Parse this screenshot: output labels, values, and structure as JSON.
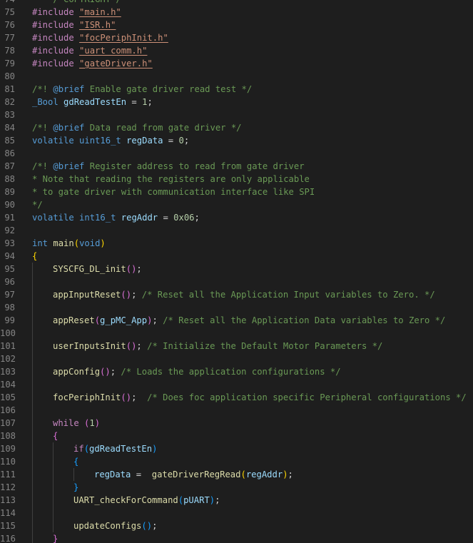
{
  "editor": {
    "language": "c",
    "lines": [
      {
        "n": "74",
        "indent": 0,
        "tokens": [
          {
            "t": "    /*COPYRIGHT*/",
            "c": "com"
          }
        ]
      },
      {
        "n": "75",
        "indent": 0,
        "tokens": [
          {
            "t": "#include",
            "c": "pp"
          },
          {
            "t": " ",
            "c": "plain"
          },
          {
            "t": "\"main.h\"",
            "c": "str"
          }
        ]
      },
      {
        "n": "76",
        "indent": 0,
        "tokens": [
          {
            "t": "#include",
            "c": "pp"
          },
          {
            "t": " ",
            "c": "plain"
          },
          {
            "t": "\"ISR.h\"",
            "c": "str"
          }
        ]
      },
      {
        "n": "77",
        "indent": 0,
        "tokens": [
          {
            "t": "#include",
            "c": "pp"
          },
          {
            "t": " ",
            "c": "plain"
          },
          {
            "t": "\"focPeriphInit.h\"",
            "c": "str"
          }
        ]
      },
      {
        "n": "78",
        "indent": 0,
        "tokens": [
          {
            "t": "#include",
            "c": "pp"
          },
          {
            "t": " ",
            "c": "plain"
          },
          {
            "t": "\"uart_comm.h\"",
            "c": "str"
          }
        ]
      },
      {
        "n": "79",
        "indent": 0,
        "tokens": [
          {
            "t": "#include",
            "c": "pp"
          },
          {
            "t": " ",
            "c": "plain"
          },
          {
            "t": "\"gateDriver.h\"",
            "c": "str"
          }
        ]
      },
      {
        "n": "80",
        "indent": 0,
        "tokens": []
      },
      {
        "n": "81",
        "indent": 0,
        "tokens": [
          {
            "t": "/*! ",
            "c": "com"
          },
          {
            "t": "@brief",
            "c": "tag"
          },
          {
            "t": " Enable gate driver read test */",
            "c": "com"
          }
        ]
      },
      {
        "n": "82",
        "indent": 0,
        "tokens": [
          {
            "t": "_Bool",
            "c": "kw"
          },
          {
            "t": " ",
            "c": "plain"
          },
          {
            "t": "gdReadTestEn",
            "c": "var"
          },
          {
            "t": " = ",
            "c": "plain"
          },
          {
            "t": "1",
            "c": "num"
          },
          {
            "t": ";",
            "c": "plain"
          }
        ]
      },
      {
        "n": "83",
        "indent": 0,
        "tokens": []
      },
      {
        "n": "84",
        "indent": 0,
        "tokens": [
          {
            "t": "/*! ",
            "c": "com"
          },
          {
            "t": "@brief",
            "c": "tag"
          },
          {
            "t": " Data read from gate driver */",
            "c": "com"
          }
        ]
      },
      {
        "n": "85",
        "indent": 0,
        "tokens": [
          {
            "t": "volatile",
            "c": "kw"
          },
          {
            "t": " ",
            "c": "plain"
          },
          {
            "t": "uint16_t",
            "c": "kw"
          },
          {
            "t": " ",
            "c": "plain"
          },
          {
            "t": "regData",
            "c": "var"
          },
          {
            "t": " = ",
            "c": "plain"
          },
          {
            "t": "0",
            "c": "num"
          },
          {
            "t": ";",
            "c": "plain"
          }
        ]
      },
      {
        "n": "86",
        "indent": 0,
        "tokens": []
      },
      {
        "n": "87",
        "indent": 0,
        "tokens": [
          {
            "t": "/*! ",
            "c": "com"
          },
          {
            "t": "@brief",
            "c": "tag"
          },
          {
            "t": " Register address to read from gate driver",
            "c": "com"
          }
        ]
      },
      {
        "n": "88",
        "indent": 0,
        "tokens": [
          {
            "t": "* Note that reading the registers are only applicable",
            "c": "com"
          }
        ]
      },
      {
        "n": "89",
        "indent": 0,
        "tokens": [
          {
            "t": "* to gate driver with communication interface like SPI",
            "c": "com"
          }
        ]
      },
      {
        "n": "90",
        "indent": 0,
        "tokens": [
          {
            "t": "*/",
            "c": "com"
          }
        ]
      },
      {
        "n": "91",
        "indent": 0,
        "tokens": [
          {
            "t": "volatile",
            "c": "kw"
          },
          {
            "t": " ",
            "c": "plain"
          },
          {
            "t": "int16_t",
            "c": "kw"
          },
          {
            "t": " ",
            "c": "plain"
          },
          {
            "t": "regAddr",
            "c": "var"
          },
          {
            "t": " = ",
            "c": "plain"
          },
          {
            "t": "0x06",
            "c": "num"
          },
          {
            "t": ";",
            "c": "plain"
          }
        ]
      },
      {
        "n": "92",
        "indent": 0,
        "tokens": []
      },
      {
        "n": "93",
        "indent": 0,
        "tokens": [
          {
            "t": "int",
            "c": "kw"
          },
          {
            "t": " ",
            "c": "plain"
          },
          {
            "t": "main",
            "c": "fn"
          },
          {
            "t": "(",
            "c": "b1"
          },
          {
            "t": "void",
            "c": "kw"
          },
          {
            "t": ")",
            "c": "b1"
          }
        ]
      },
      {
        "n": "94",
        "indent": 0,
        "tokens": [
          {
            "t": "{",
            "c": "b1"
          }
        ]
      },
      {
        "n": "95",
        "indent": 1,
        "tokens": [
          {
            "t": "SYSCFG_DL_init",
            "c": "fn"
          },
          {
            "t": "()",
            "c": "b2"
          },
          {
            "t": ";",
            "c": "plain"
          }
        ]
      },
      {
        "n": "96",
        "indent": 1,
        "tokens": []
      },
      {
        "n": "97",
        "indent": 1,
        "tokens": [
          {
            "t": "appInputReset",
            "c": "fn"
          },
          {
            "t": "()",
            "c": "b2"
          },
          {
            "t": "; ",
            "c": "plain"
          },
          {
            "t": "/* Reset all the Application Input variables to Zero. */",
            "c": "com"
          }
        ]
      },
      {
        "n": "98",
        "indent": 1,
        "tokens": []
      },
      {
        "n": "99",
        "indent": 1,
        "tokens": [
          {
            "t": "appReset",
            "c": "fn"
          },
          {
            "t": "(",
            "c": "b2"
          },
          {
            "t": "g_pMC_App",
            "c": "var"
          },
          {
            "t": ")",
            "c": "b2"
          },
          {
            "t": "; ",
            "c": "plain"
          },
          {
            "t": "/* Reset all the Application Data variables to Zero */",
            "c": "com"
          }
        ]
      },
      {
        "n": "100",
        "indent": 1,
        "tokens": []
      },
      {
        "n": "101",
        "indent": 1,
        "tokens": [
          {
            "t": "userInputsInit",
            "c": "fn"
          },
          {
            "t": "()",
            "c": "b2"
          },
          {
            "t": "; ",
            "c": "plain"
          },
          {
            "t": "/* Initialize the Default Motor Parameters */",
            "c": "com"
          }
        ]
      },
      {
        "n": "102",
        "indent": 1,
        "tokens": []
      },
      {
        "n": "103",
        "indent": 1,
        "tokens": [
          {
            "t": "appConfig",
            "c": "fn"
          },
          {
            "t": "()",
            "c": "b2"
          },
          {
            "t": "; ",
            "c": "plain"
          },
          {
            "t": "/* Loads the application configurations */",
            "c": "com"
          }
        ]
      },
      {
        "n": "104",
        "indent": 1,
        "tokens": []
      },
      {
        "n": "105",
        "indent": 1,
        "tokens": [
          {
            "t": "focPeriphInit",
            "c": "fn"
          },
          {
            "t": "()",
            "c": "b2"
          },
          {
            "t": ";  ",
            "c": "plain"
          },
          {
            "t": "/* Does foc application specific Peripheral configurations */",
            "c": "com"
          }
        ]
      },
      {
        "n": "106",
        "indent": 1,
        "tokens": []
      },
      {
        "n": "107",
        "indent": 1,
        "tokens": [
          {
            "t": "while",
            "c": "ctl"
          },
          {
            "t": " ",
            "c": "plain"
          },
          {
            "t": "(",
            "c": "b2"
          },
          {
            "t": "1",
            "c": "num"
          },
          {
            "t": ")",
            "c": "b2"
          }
        ]
      },
      {
        "n": "108",
        "indent": 1,
        "tokens": [
          {
            "t": "{",
            "c": "b2"
          }
        ]
      },
      {
        "n": "109",
        "indent": 2,
        "tokens": [
          {
            "t": "if",
            "c": "ctl"
          },
          {
            "t": "(",
            "c": "b3"
          },
          {
            "t": "gdReadTestEn",
            "c": "var"
          },
          {
            "t": ")",
            "c": "b3"
          }
        ]
      },
      {
        "n": "110",
        "indent": 2,
        "tokens": [
          {
            "t": "{",
            "c": "b3"
          }
        ]
      },
      {
        "n": "111",
        "indent": 3,
        "tokens": [
          {
            "t": "regData",
            "c": "var"
          },
          {
            "t": " =  ",
            "c": "plain"
          },
          {
            "t": "gateDriverRegRead",
            "c": "fn"
          },
          {
            "t": "(",
            "c": "b1"
          },
          {
            "t": "regAddr",
            "c": "var"
          },
          {
            "t": ")",
            "c": "b1"
          },
          {
            "t": ";",
            "c": "plain"
          }
        ]
      },
      {
        "n": "112",
        "indent": 2,
        "tokens": [
          {
            "t": "}",
            "c": "b3"
          }
        ]
      },
      {
        "n": "113",
        "indent": 2,
        "tokens": [
          {
            "t": "UART_checkForCommand",
            "c": "fn"
          },
          {
            "t": "(",
            "c": "b3"
          },
          {
            "t": "pUART",
            "c": "var"
          },
          {
            "t": ")",
            "c": "b3"
          },
          {
            "t": ";",
            "c": "plain"
          }
        ]
      },
      {
        "n": "114",
        "indent": 2,
        "tokens": []
      },
      {
        "n": "115",
        "indent": 2,
        "tokens": [
          {
            "t": "updateConfigs",
            "c": "fn"
          },
          {
            "t": "()",
            "c": "b3"
          },
          {
            "t": ";",
            "c": "plain"
          }
        ]
      },
      {
        "n": "116",
        "indent": 1,
        "tokens": [
          {
            "t": "}",
            "c": "b2"
          }
        ]
      }
    ]
  },
  "colors": {
    "background": "#1e1e1e",
    "line_number": "#858585",
    "keyword": "#569cd6",
    "control": "#c586c0",
    "function": "#dcdcaa",
    "variable": "#9cdcfe",
    "number": "#b5cea8",
    "string": "#ce9178",
    "comment": "#6a9955"
  }
}
